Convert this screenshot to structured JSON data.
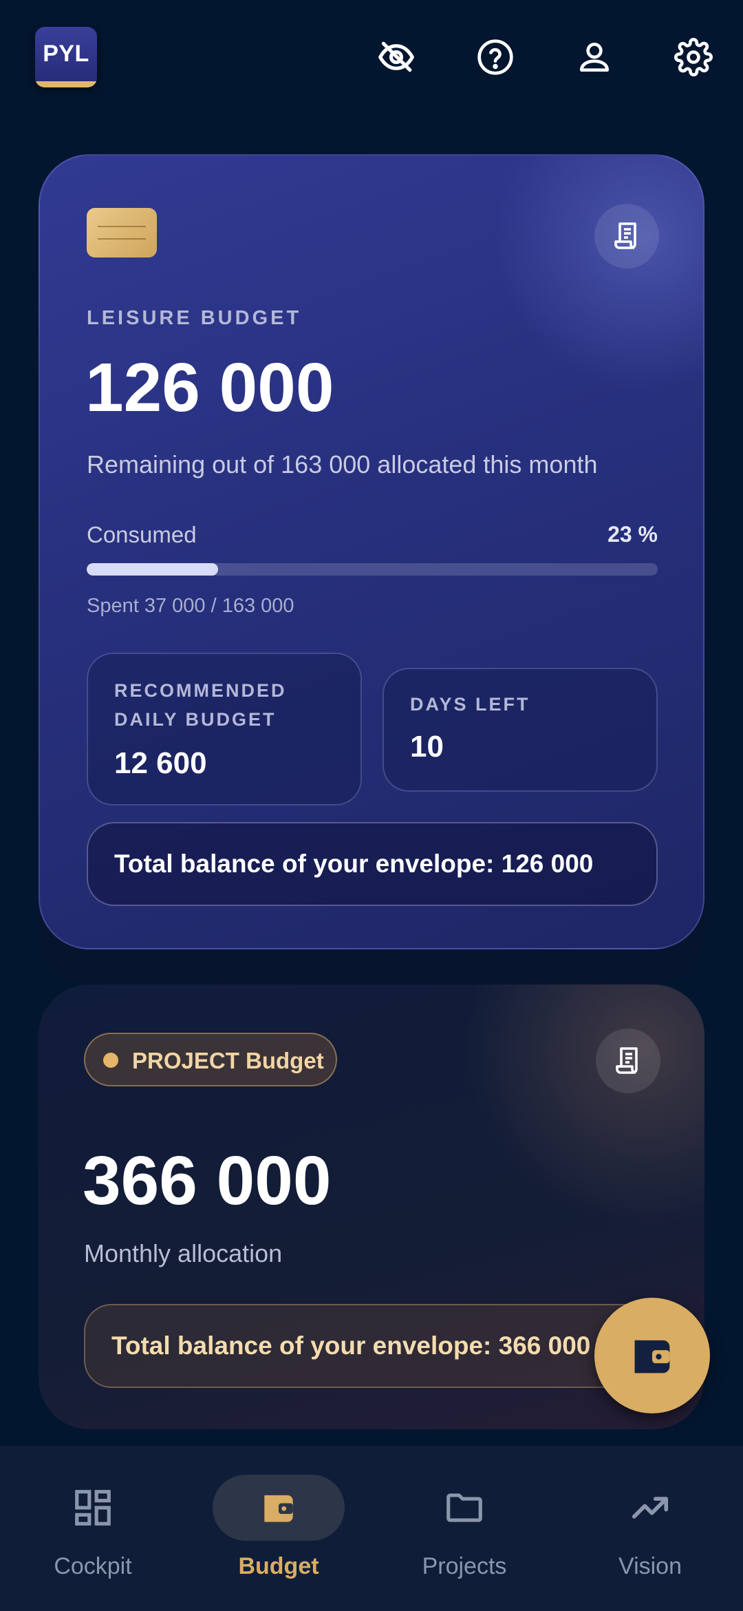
{
  "header": {
    "logo_text": "PYL",
    "icons": [
      "eye-off-icon",
      "help-icon",
      "user-icon",
      "settings-icon"
    ]
  },
  "leisure_card": {
    "label": "LEISURE BUDGET",
    "amount": "126 000",
    "subtitle": "Remaining out of 163 000 allocated this month",
    "consumed_label": "Consumed",
    "consumed_percent": "23 %",
    "progress_fraction": 0.23,
    "spent_text": "Spent 37 000 / 163 000",
    "recommended_label_line1": "RECOMMENDED",
    "recommended_label_line2": "DAILY BUDGET",
    "recommended_value": "12 600",
    "days_left_label": "DAYS LEFT",
    "days_left_value": "10",
    "total_balance": "Total balance of your envelope: 126 000"
  },
  "project_card": {
    "tag": "PROJECT Budget",
    "amount": "366 000",
    "subtitle": "Monthly allocation",
    "total_balance": "Total balance of your envelope: 366 000"
  },
  "bottom_nav": {
    "items": [
      {
        "label": "Cockpit",
        "icon": "dashboard-icon",
        "active": false
      },
      {
        "label": "Budget",
        "icon": "wallet-icon",
        "active": true
      },
      {
        "label": "Projects",
        "icon": "folder-icon",
        "active": false
      },
      {
        "label": "Vision",
        "icon": "trending-up-icon",
        "active": false
      }
    ]
  },
  "colors": {
    "background": "#03162f",
    "accent_gold": "#d9ad63",
    "card_indigo": "#2a3383",
    "nav_background": "#0f1d38"
  }
}
